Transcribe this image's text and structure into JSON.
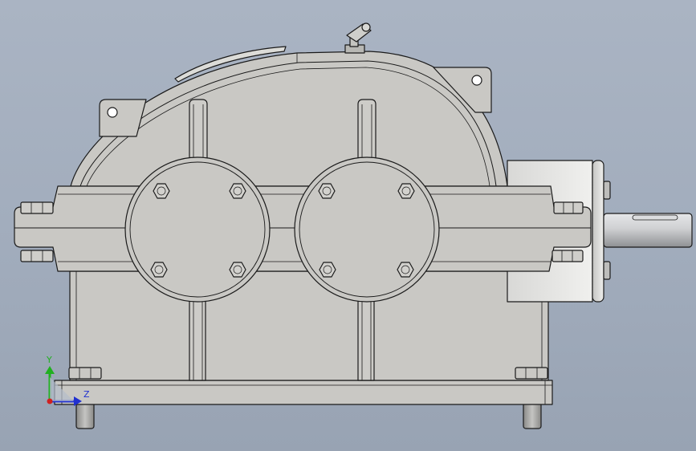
{
  "viewport": {
    "background_top": "#aab4c3",
    "background_bottom": "#98a3b3"
  },
  "model": {
    "body_color": "#c9c8c4",
    "shade_color": "#b9b8b4",
    "edge_color": "#1a1a1a",
    "shaft_color": "#cfd0d2"
  },
  "triad": {
    "y_label": "Y",
    "z_label": "Z",
    "y_color": "#20b020",
    "z_color": "#2030d0",
    "x_color": "#d02020"
  }
}
